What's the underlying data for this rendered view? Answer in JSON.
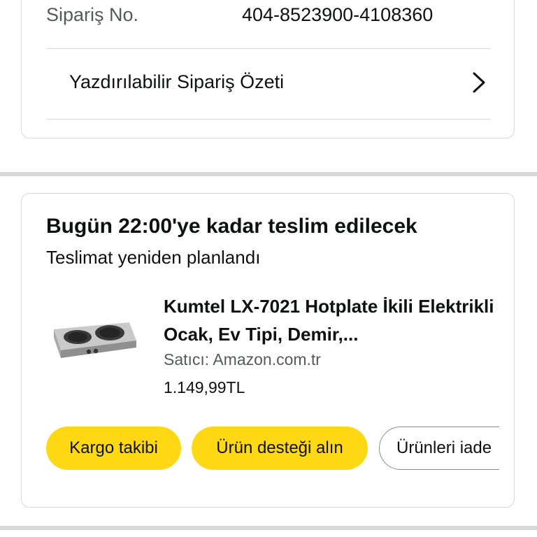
{
  "order_card": {
    "order_no_label": "Sipariş No.",
    "order_no_value": "404-8523900-4108360",
    "printable_summary_label": "Yazdırılabilir Sipariş Özeti",
    "printable_summary_icon": "chevron-right-icon"
  },
  "delivery_card": {
    "title": "Bugün 22:00'ye kadar teslim edilecek",
    "subtitle": "Teslimat yeniden planlandı",
    "product": {
      "image_icon": "hotplate-image",
      "title": "Kumtel LX-7021 Hotplate İkili Elektrikli Ocak, Ev Tipi, Demir,...",
      "seller": "Satıcı: Amazon.com.tr",
      "price": "1.149,99TL"
    },
    "buttons": {
      "track": "Kargo takibi",
      "support": "Ürün desteği alın",
      "return": "Ürünleri iade"
    }
  },
  "colors": {
    "button_yellow": "#ffd814",
    "border": "#d5d9d9",
    "secondary_text": "#565959"
  }
}
